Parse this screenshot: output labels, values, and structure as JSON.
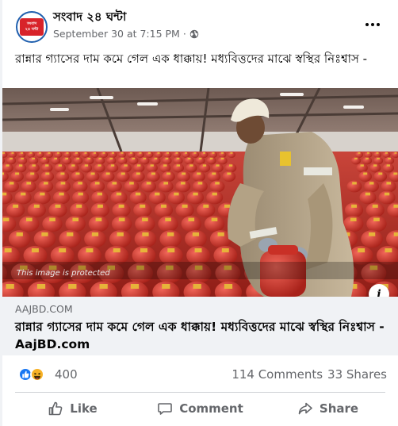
{
  "post": {
    "page_name": "সংবাদ ২৪ ঘন্টা",
    "timestamp": "September 30 at 7:15 PM",
    "separator": "·",
    "avatar_text_top": "সংবাদ",
    "avatar_text_bottom": "২৪ ঘন্টা",
    "caption": "রান্নার গ্যাসের দাম কমে গেল এক ধাক্কায়! মধ্যবিত্তদের মাঝে স্বস্থির নিঃশ্বাস -"
  },
  "media": {
    "protected_label": "This image is protected",
    "info_label": "i"
  },
  "link": {
    "domain": "AAJBD.COM",
    "title": "রান্নার গ্যাসের দাম কমে গেল এক ধাক্কায়! মধ্যবিত্তদের মাঝে স্বস্থির নিঃশ্বাস - AajBD.com"
  },
  "reactions": {
    "count": "400",
    "comments": "114 Comments",
    "shares": "33 Shares",
    "icons": [
      "like-icon",
      "haha-icon"
    ]
  },
  "actions": {
    "like": "Like",
    "comment": "Comment",
    "share": "Share"
  },
  "colors": {
    "like_blue": "#1877f2",
    "haha_yellow": "#f7b125",
    "text_secondary": "#65676b",
    "cylinder_red": "#d8342a"
  }
}
